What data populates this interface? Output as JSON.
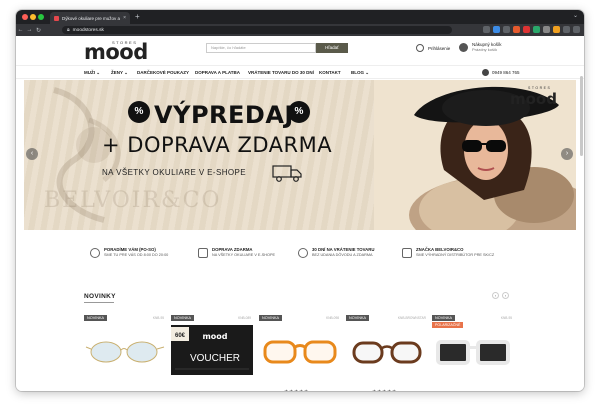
{
  "browser": {
    "tab_title": "Dýkové okuliare pre mužov a ženy",
    "new_tab": "+",
    "url": "moodstores.sk"
  },
  "header": {
    "logo_small": "STORES",
    "logo_main": "mood",
    "search_placeholder": "Napíšte, čo hľadáte",
    "search_button": "Hľadať",
    "login": "Prihlásenie",
    "cart_title": "Nákupný košík",
    "cart_sub": "Prázdny košík"
  },
  "nav": {
    "items": [
      "MUŽI ⌄",
      "ŽENY ⌄",
      "DARČEKOVÉ POUKAZY",
      "DOPRAVA A PLATBA",
      "VRÁTENIE TOVARU DO 30 DNÍ",
      "KONTAKT",
      "BLOG ⌄"
    ],
    "phone": "0949 864 765"
  },
  "hero": {
    "title": "VÝPREDAJ",
    "badge_glyph": "%",
    "subtitle": "+ DOPRAVA ZDARMA",
    "small": "NA VŠETKY OKULIARE V E-SHOPE",
    "watermark": "BELVOIR&CO",
    "logo": "mood",
    "logo_small": "STORES"
  },
  "benefits": [
    {
      "title": "PORADÍME VÁM (PO-SO)",
      "sub": "SME TU PRE VÁS OD 8:00 DO 20:00"
    },
    {
      "title": "DOPRAVA ZDARMA",
      "sub": "NA VŠETKY OKULIARE V E-SHOPE"
    },
    {
      "title": "30 DNÍ NA VRÁTENIE TOVARU",
      "sub": "BEZ UDANIA DÔVODU A ZDARMA"
    },
    {
      "title": "ZNAČKA BELVOIR&CO",
      "sub": "SME VÝHRADNÝ DISTRIBÚTOR PRE SK/CZ"
    }
  ],
  "products_section": {
    "title": "NOVINKY",
    "prev": "‹",
    "next": "›"
  },
  "products": [
    {
      "tag": "NOVINKA",
      "tag2": "",
      "code": "KNB-95",
      "frame": "rimless"
    },
    {
      "tag": "NOVINKA",
      "tag2": "",
      "code": "KNB-089",
      "voucher_amount": "60€",
      "voucher_label": "VOUCHER",
      "voucher_logo": "mood"
    },
    {
      "tag": "NOVINKA",
      "tag2": "",
      "code": "KNB-098",
      "frame": "orange"
    },
    {
      "tag": "NOVINKA",
      "tag2": "",
      "code": "KNB-BROWNSTAR",
      "frame": "tortoise"
    },
    {
      "tag": "NOVINKA",
      "tag2": "POLARIZAČNÉ",
      "code": "KNB-95",
      "frame": "white"
    }
  ],
  "ratings": {
    "stars": "★★★★★"
  },
  "colors": {
    "hero_bg": "#e8dcc8",
    "search_button": "#5a5a4a",
    "tag": "#555555",
    "polarized_tag": "#e8734a"
  }
}
